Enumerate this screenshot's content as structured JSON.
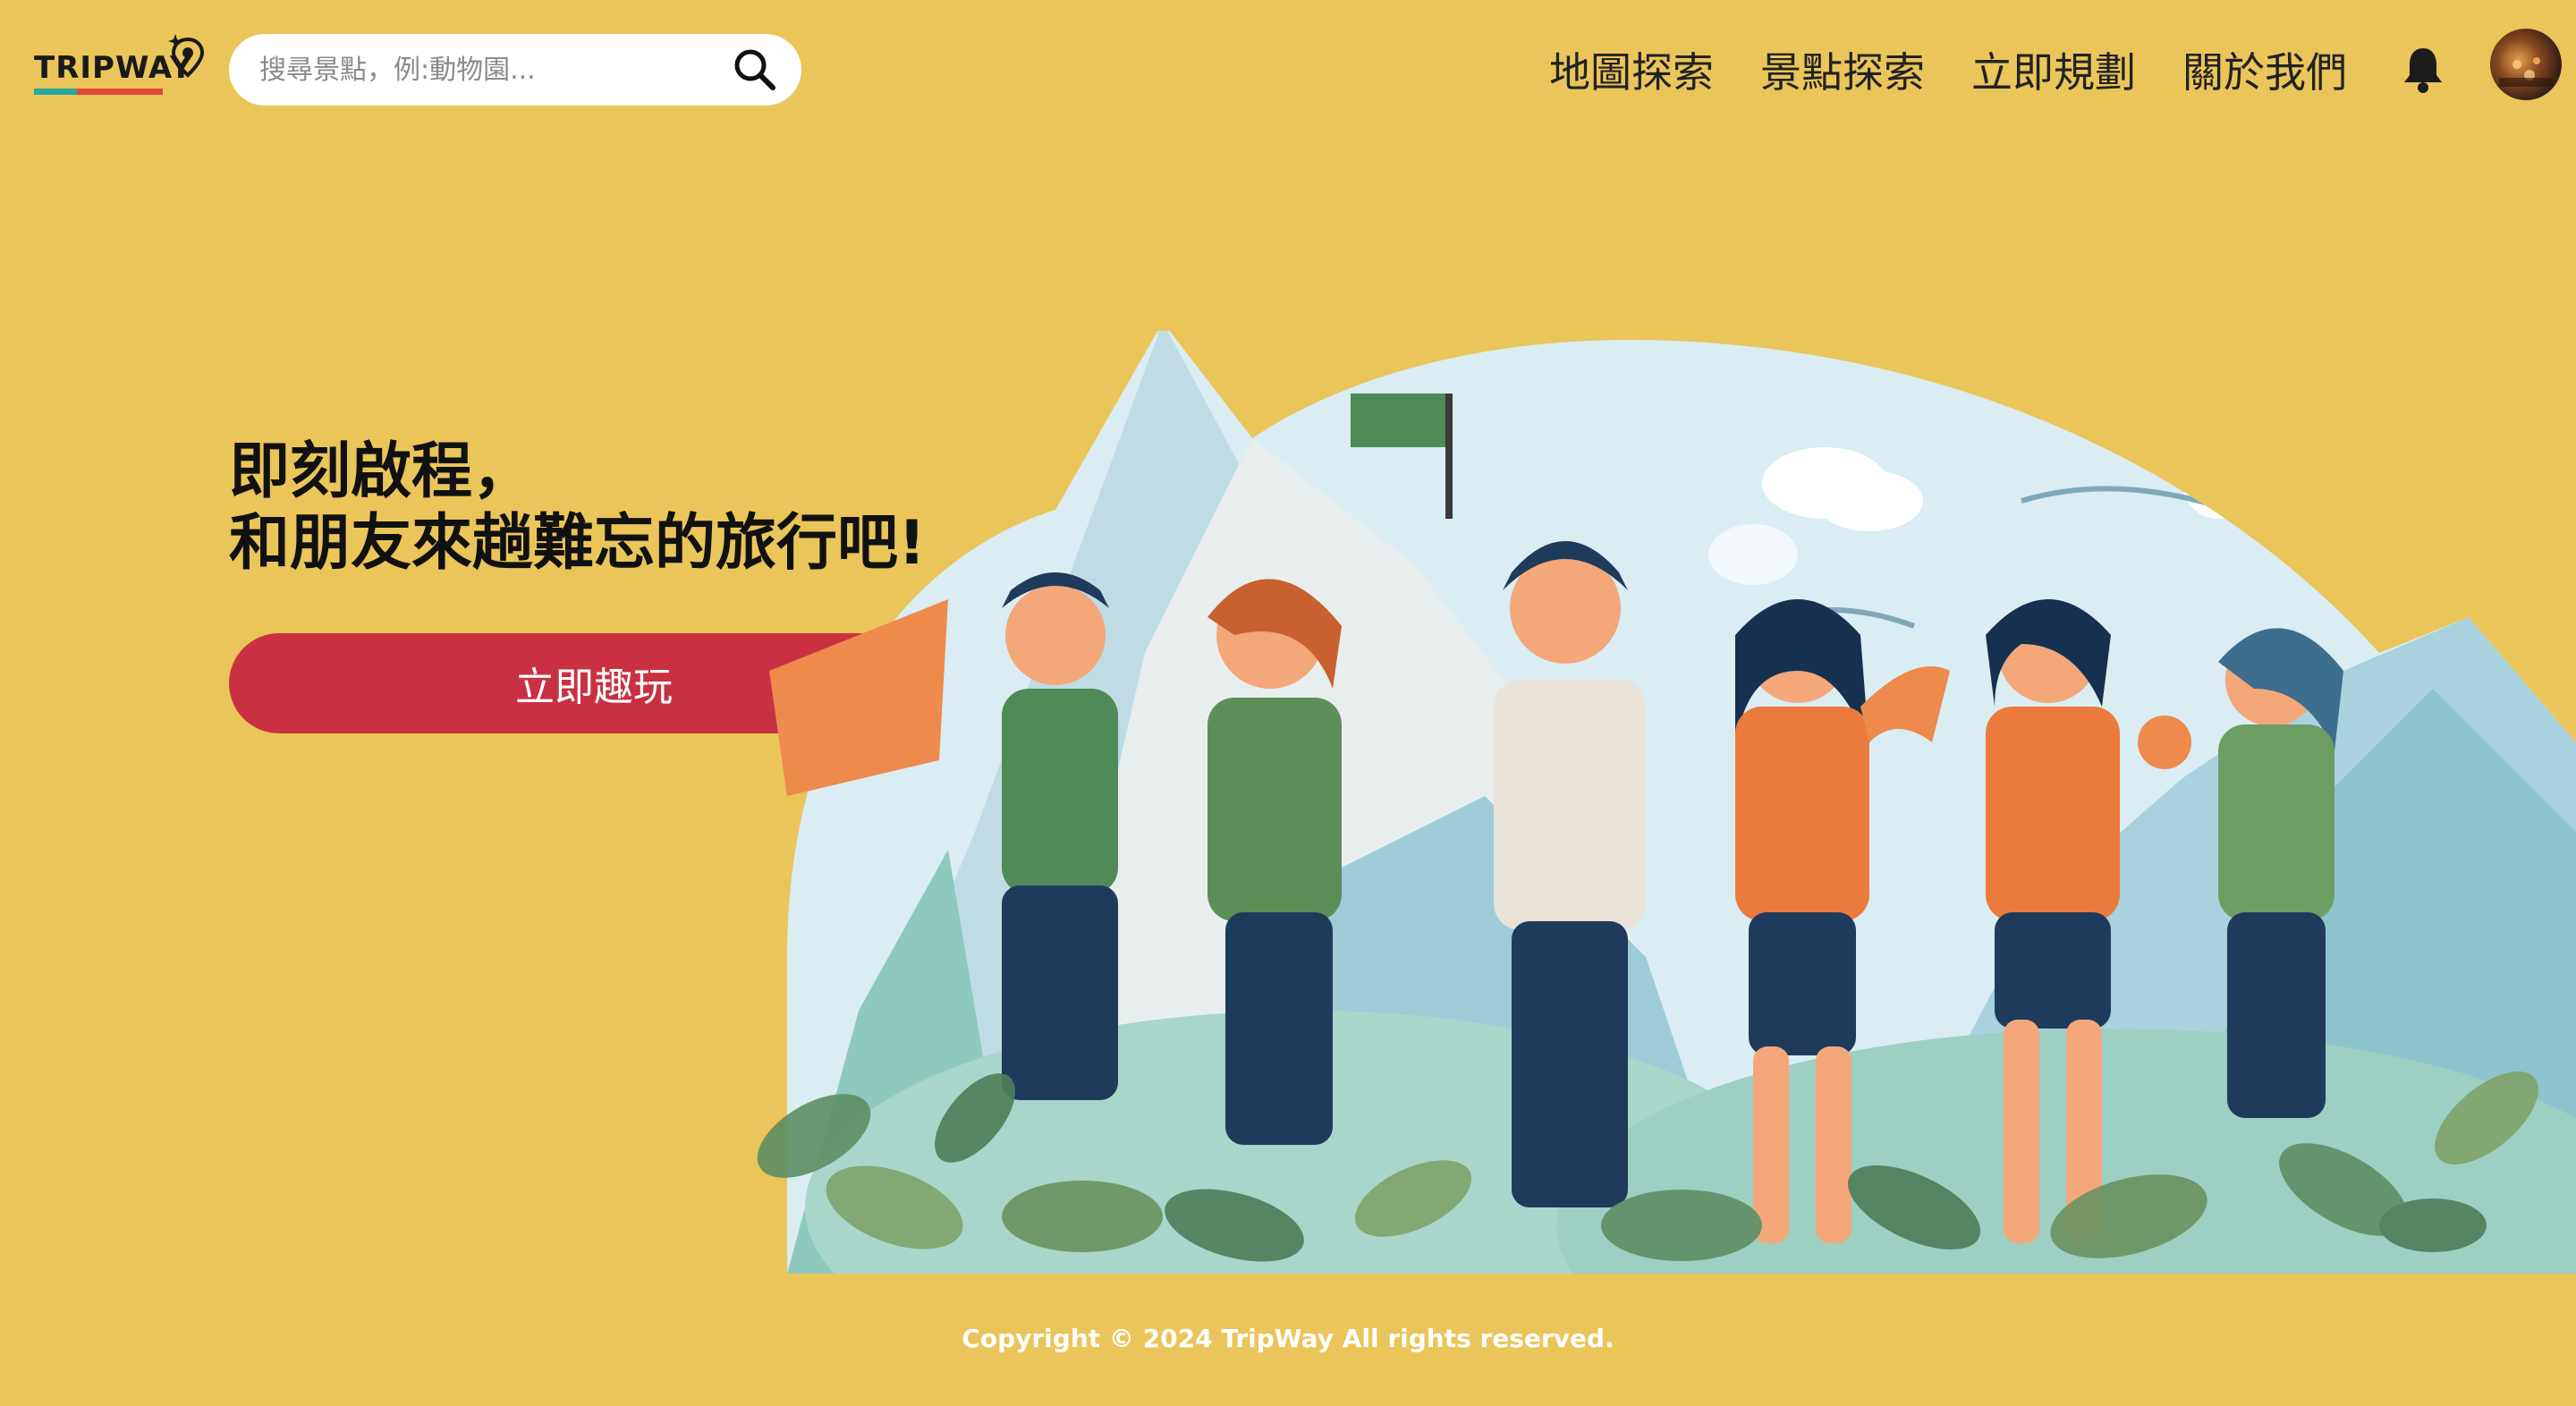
{
  "header": {
    "logo_text": "TRIPWAY",
    "search": {
      "placeholder": "搜尋景點，例:動物園..."
    },
    "nav": {
      "map_explore": "地圖探索",
      "spot_explore": "景點探索",
      "plan_now": "立即規劃",
      "about_us": "關於我們"
    },
    "icons": [
      "search-icon",
      "bell-icon",
      "user-avatar"
    ]
  },
  "hero": {
    "title_line1": "即刻啟程，",
    "title_line2": "和朋友來趟難忘的旅行吧!",
    "cta_label": "立即趣玩"
  },
  "footer": {
    "copyright": "Copyright © 2024 TripWay All rights reserved."
  },
  "colors": {
    "background": "#EAC55A",
    "cta": "#C93143",
    "logo_teal": "#2aa7a0",
    "logo_red": "#e0473a"
  }
}
